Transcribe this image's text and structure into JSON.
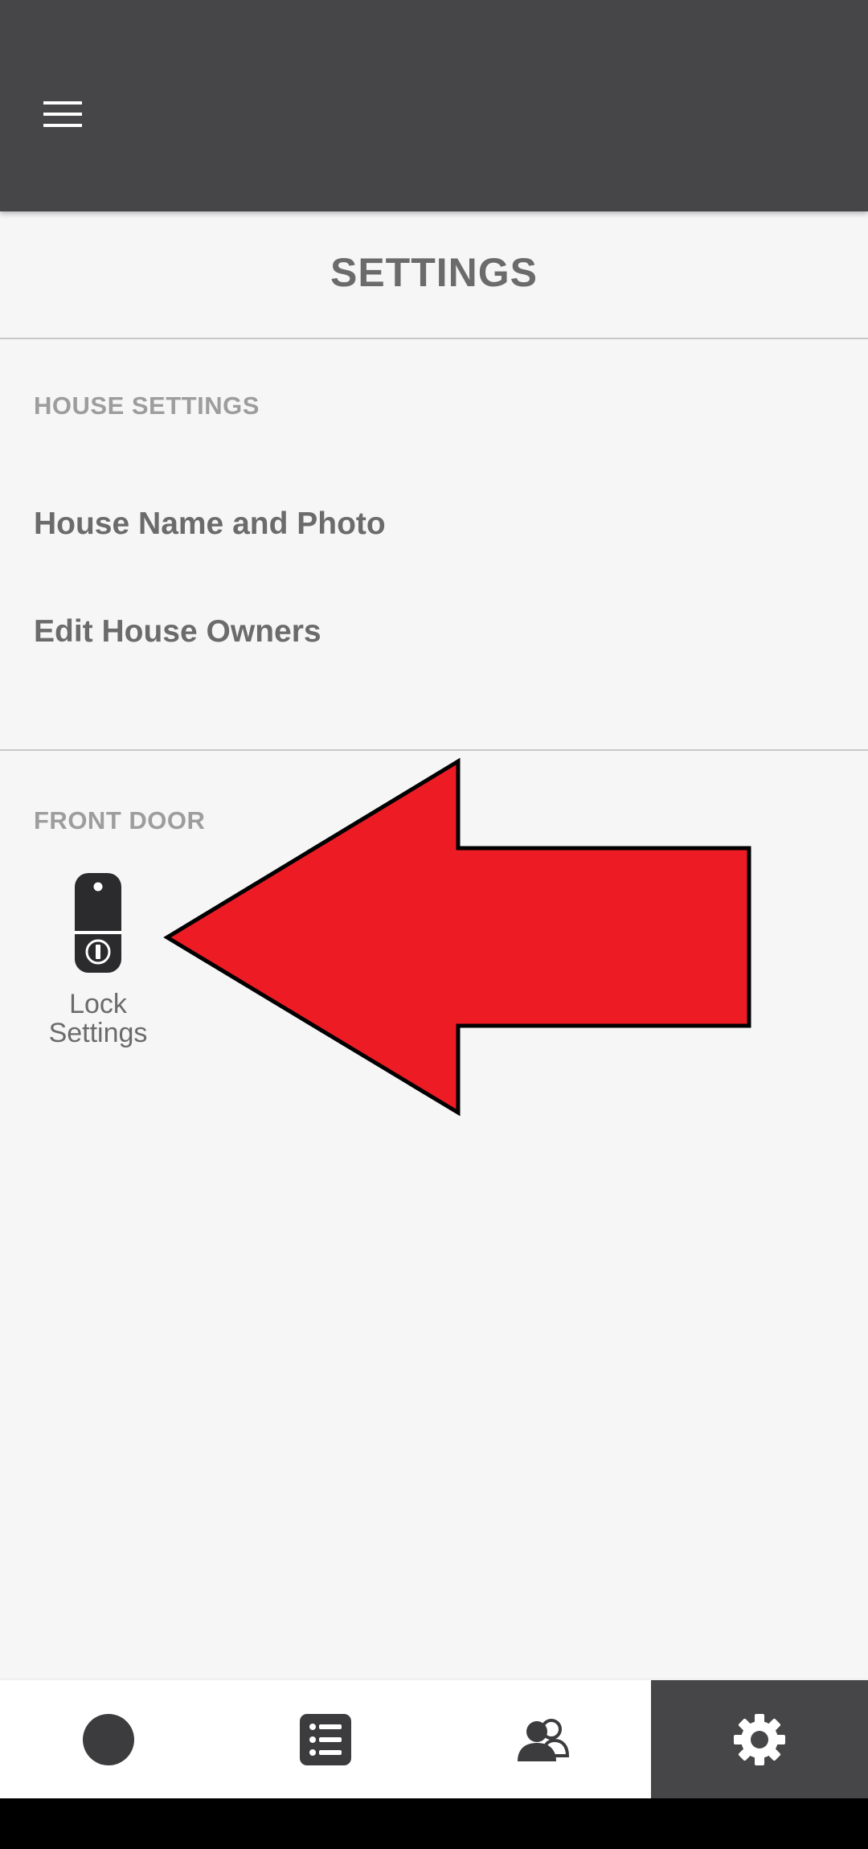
{
  "header": {
    "menu_icon": "hamburger-menu-icon"
  },
  "page": {
    "title": "SETTINGS"
  },
  "house_settings": {
    "header": "HOUSE SETTINGS",
    "items": [
      {
        "label": "House Name and Photo"
      },
      {
        "label": "Edit House Owners"
      }
    ]
  },
  "front_door": {
    "header": "FRONT DOOR",
    "lock_tile": {
      "label": "Lock Settings",
      "icon": "smart-lock-icon"
    }
  },
  "annotation": {
    "icon": "red-arrow-pointer",
    "color": "#ed1c24"
  },
  "bottom_nav": {
    "tabs": [
      {
        "icon": "circle-home-icon",
        "active": false
      },
      {
        "icon": "activity-list-icon",
        "active": false
      },
      {
        "icon": "guests-users-icon",
        "active": false
      },
      {
        "icon": "gear-icon",
        "active": true
      }
    ]
  },
  "colors": {
    "header_bg": "#464648",
    "page_bg": "#f6f6f6",
    "text_primary": "#6b6b6b",
    "text_secondary": "#9d9d9d",
    "arrow_fill": "#ed1c24"
  }
}
